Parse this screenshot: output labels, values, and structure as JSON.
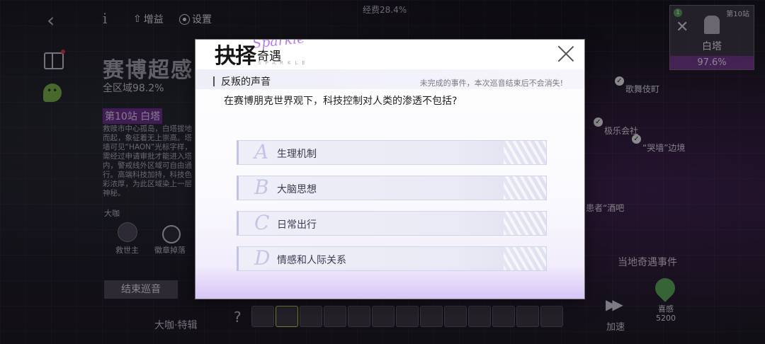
{
  "hud": {
    "back_icon": "‹",
    "info_icon": "i",
    "gain_label": "增益",
    "settings_label": "设置",
    "progress_text": "经费28.4%"
  },
  "region": {
    "title": "赛博超感",
    "progress": "全区域98.2%",
    "station_badge": "第10站 白塔",
    "description": "救赎市中心孤岛，白塔拔地而起，象征着无上崇高。塔墙可见“HAON”光标字样，需经过申请审批才能进入塔内，警戒线外区域可自由通行。高端科技加持，科技色彩浓厚，为此区域染上一层神秘。",
    "narrator_small": "大咖",
    "savior_label": "救世主",
    "badge_drop_label": "徽章掉落",
    "end_tour_label": "结束巡音",
    "narrator_bottom": "大咖·特辑"
  },
  "station_card": {
    "number": "第10站",
    "level": "1",
    "name": "白塔",
    "percent": "97.6%"
  },
  "map": {
    "labels": [
      "歌舞伎町",
      "极乐会社",
      "“哭墙”边境",
      "患者“酒吧"
    ],
    "local_events": "当地奇遇事件",
    "speed_label": "加速",
    "xigan_label": "喜感",
    "xigan_value": "5200"
  },
  "modal": {
    "title_main": "抉择",
    "title_sub": "奇遇",
    "sparkle_script": "Sparkle",
    "sparkle_caps": "SPARKLE",
    "event_title": "反叛的声音",
    "event_note": "未完成的事件，本次巡音结束后不会消失!",
    "question": "在赛博朋克世界观下，科技控制对人类的渗透不包括?",
    "options": [
      {
        "letter": "A",
        "text": "生理机制"
      },
      {
        "letter": "B",
        "text": "大脑思想"
      },
      {
        "letter": "C",
        "text": "日常出行"
      },
      {
        "letter": "D",
        "text": "情感和人际关系"
      }
    ]
  }
}
